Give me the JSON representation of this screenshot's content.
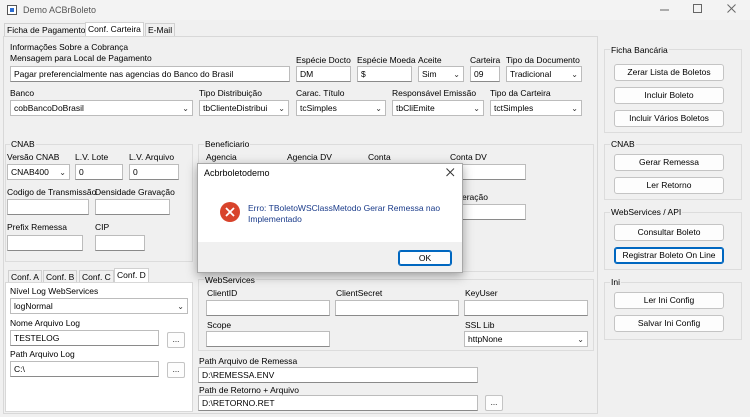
{
  "window": {
    "title": "Demo ACBrBoleto",
    "minimize_icon": "minimize-icon",
    "maximize_icon": "maximize-icon",
    "close_icon": "close-icon"
  },
  "top_tabs": [
    "Ficha de Pagamento",
    "Conf. Carteira",
    "E-Mail"
  ],
  "info_cobranca": {
    "group_title": "Informações Sobre a Cobrança",
    "mensagem_label": "Mensagem para Local de Pagamento",
    "mensagem_value": "Pagar preferencialmente nas agencias do Banco do Brasil",
    "especie_docto_label": "Espécie Docto",
    "especie_docto_value": "DM",
    "especie_moeda_label": "Espécie Moeda",
    "especie_moeda_value": "$",
    "aceite_label": "Aceite",
    "aceite_value": "Sim",
    "carteira_label": "Carteira",
    "carteira_value": "09",
    "tipo_documento_label": "Tipo da Documento",
    "tipo_documento_value": "Tradicional",
    "banco_label": "Banco",
    "banco_value": "cobBancoDoBrasil",
    "tipo_distribuicao_label": "Tipo Distribuição",
    "tipo_distribuicao_value": "tbClienteDistribui",
    "carac_titulo_label": "Carac. Título",
    "carac_titulo_value": "tcSimples",
    "responsavel_emissao_label": "Responsável Emissão",
    "responsavel_emissao_value": "tbCliEmite",
    "tipo_carteira_label": "Tipo da Carteira",
    "tipo_carteira_value": "tctSimples"
  },
  "cnab": {
    "group_title": "CNAB",
    "versao_label": "Versão CNAB",
    "versao_value": "CNAB400",
    "lv_lote_label": "L.V. Lote",
    "lv_lote_value": "0",
    "lv_arquivo_label": "L.V. Arquivo",
    "lv_arquivo_value": "0",
    "codigo_transmissao_label": "Codigo de Transmissão",
    "densidade_gravacao_label": "Densidade Gravação",
    "prefix_remessa_label": "Prefix Remessa",
    "cip_label": "CIP"
  },
  "beneficiario": {
    "group_title": "Beneficiario",
    "agencia_label": "Agencia",
    "agencia_dv_label": "Agencia DV",
    "conta_label": "Conta",
    "conta_dv_label": "Conta DV",
    "partial_label": "eração"
  },
  "conf_tabs": [
    "Conf. A",
    "Conf. B",
    "Conf. C",
    "Conf. D"
  ],
  "conf_d": {
    "nivel_log_label": "Nível Log WebServices",
    "nivel_log_value": "logNormal",
    "nome_arquivo_log_label": "Nome Arquivo Log",
    "nome_arquivo_log_value": "TESTELOG",
    "path_arquivo_log_label": "Path Arquivo Log",
    "path_arquivo_log_value": "C:\\",
    "browse_label": "..."
  },
  "webservices": {
    "group_title": "WebServices",
    "client_id_label": "ClientID",
    "client_secret_label": "ClientSecret",
    "key_user_label": "KeyUser",
    "scope_label": "Scope",
    "ssl_lib_label": "SSL Lib",
    "ssl_lib_value": "httpNone"
  },
  "paths": {
    "path_remessa_label": "Path Arquivo de Remessa",
    "path_remessa_value": "D:\\REMESSA.ENV",
    "path_retorno_label": "Path de Retorno + Arquivo",
    "path_retorno_value": "D:\\RETORNO.RET",
    "browse_label": "..."
  },
  "ficha_bancaria": {
    "group_title": "Ficha Bancária",
    "zerar_label": "Zerar Lista de Boletos",
    "incluir_label": "Incluir Boleto",
    "incluir_varios_label": "Incluir Vários Boletos"
  },
  "cnab_panel": {
    "group_title": "CNAB",
    "gerar_remessa_label": "Gerar Remessa",
    "ler_retorno_label": "Ler Retorno"
  },
  "webservices_api": {
    "group_title": "WebServices / API",
    "consultar_label": "Consultar Boleto",
    "registrar_label": "Registrar Boleto On Line"
  },
  "ini": {
    "group_title": "Ini",
    "ler_label": "Ler Ini Config",
    "salvar_label": "Salvar Ini Config"
  },
  "dialog": {
    "title": "Acbrboletodemo",
    "message": "Erro: TBoletoWSClassMetodo Gerar Remessa nao Implementado",
    "ok_label": "OK",
    "error_color": "#d8432b"
  }
}
